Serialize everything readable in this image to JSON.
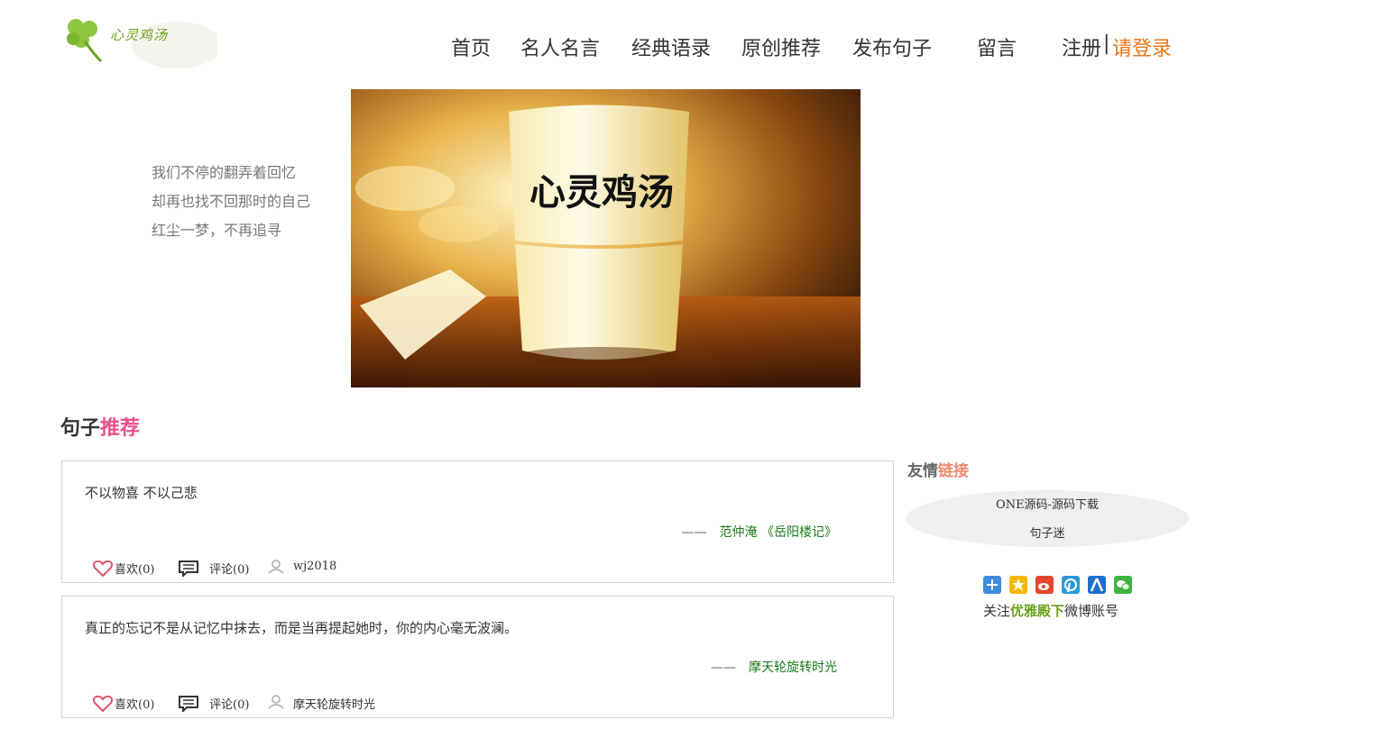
{
  "logo": {
    "text": "心灵鸡汤"
  },
  "nav": {
    "items": [
      "首页",
      "名人名言",
      "经典语录",
      "原创推荐",
      "发布句子",
      "留言"
    ],
    "register": "注册",
    "separator": "|",
    "login": "请登录"
  },
  "slogan": [
    "我们不停的翻弄着回忆",
    "却再也找不回那时的自己",
    "红尘一梦，不再追寻"
  ],
  "banner": {
    "caption": "心灵鸡汤"
  },
  "section": {
    "title_a": "句子",
    "title_b": "推荐"
  },
  "posts": [
    {
      "text": "不以物喜 不以己悲",
      "dash": "——",
      "source": "范仲淹 《岳阳楼记》",
      "like_label": "喜欢(0)",
      "comment_label": "评论(0)",
      "author": "wj2018"
    },
    {
      "text": "真正的忘记不是从记忆中抹去，而是当再提起她时，你的内心毫无波澜。",
      "dash": "——",
      "source": "摩天轮旋转时光",
      "like_label": "喜欢(0)",
      "comment_label": "评论(0)",
      "author": "摩天轮旋转时光"
    }
  ],
  "sidebar": {
    "title_a": "友情",
    "title_b": "链接",
    "links": [
      "ONE源码-源码下载",
      "句子迷"
    ],
    "follow_a": "关注",
    "follow_b": "优雅殿下",
    "follow_c": "微博账号",
    "share_icons": [
      "plus-icon",
      "qzone-icon",
      "weibo-icon",
      "pinterest-icon",
      "renren-icon",
      "wechat-icon"
    ]
  },
  "colors": {
    "accent_pink": "#e6508a",
    "login_orange": "#e87a1a",
    "brand_green": "#6aa31b",
    "source_green": "#1a7a1a"
  }
}
